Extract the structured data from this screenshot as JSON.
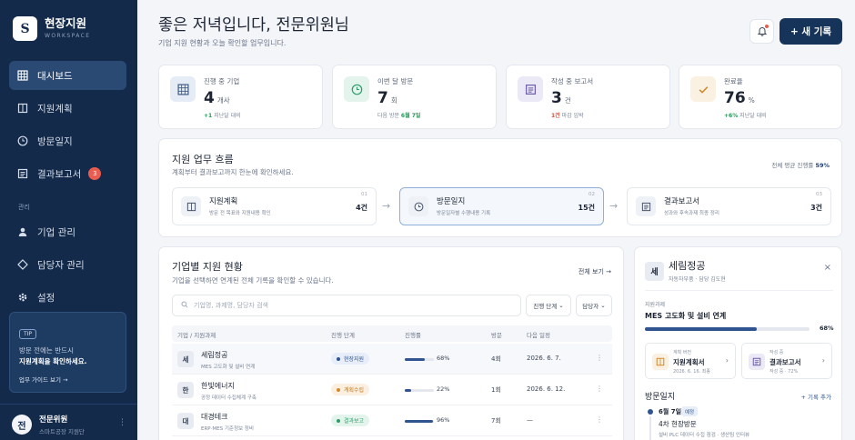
{
  "sidebar": {
    "logo_letter": "S",
    "brand": "현장지원",
    "brand_sub": "WORKSPACE",
    "nav": [
      {
        "label": "대시보드",
        "icon": "grid-icon"
      },
      {
        "label": "지원계획",
        "icon": "book-icon"
      },
      {
        "label": "방문일지",
        "icon": "clock-icon"
      },
      {
        "label": "결과보고서",
        "icon": "report-icon",
        "badge": "3"
      }
    ],
    "section_label": "관리",
    "manage": [
      {
        "label": "기업 관리",
        "icon": "user-icon"
      },
      {
        "label": "담당자 관리",
        "icon": "diamond-icon"
      },
      {
        "label": "설정",
        "icon": "gear-icon"
      }
    ],
    "tip": {
      "tag": "TIP",
      "line1": "방문 전에는 반드시",
      "line2": "지원계획을 확인하세요.",
      "link": "업무 가이드 보기 →"
    },
    "user": {
      "avatar": "전",
      "name": "전문위원",
      "role": "스마트공장 지원단",
      "more": "⋮"
    }
  },
  "header": {
    "greeting": "좋은 저녁입니다, 전문위원님",
    "subtitle": "기업 지원 현황과 오늘 확인할 업무입니다.",
    "new_button": "+ 새 기록"
  },
  "stats": [
    {
      "label": "진행 중 기업",
      "value": "4",
      "unit": "개사",
      "foot_hl": "+1",
      "foot": " 지난달 대비",
      "hl": "green",
      "icon": "grid-icon",
      "color": "#e6ecf5",
      "icon_color": "#3e5b86"
    },
    {
      "label": "이번 달 방문",
      "value": "7",
      "unit": "회",
      "foot_pre": "다음 방문 ",
      "foot_hl": "6월 7일",
      "foot": "",
      "hl": "green",
      "icon": "clock-icon",
      "color": "#e3f4ec",
      "icon_color": "#2f9a6a"
    },
    {
      "label": "작성 중 보고서",
      "value": "3",
      "unit": "건",
      "foot_hl": "1건",
      "foot": " 마감 임박",
      "hl": "red",
      "icon": "report-icon",
      "color": "#ece9f6",
      "icon_color": "#6c5ca8"
    },
    {
      "label": "완료율",
      "value": "76",
      "unit": "%",
      "foot_hl": "+6%",
      "foot": " 지난달 대비",
      "hl": "green",
      "icon": "check-icon",
      "color": "#fbf1e2",
      "icon_color": "#d18a2b"
    }
  ],
  "flow": {
    "title": "지원 업무 흐름",
    "subtitle": "계획부터 결과보고까지 한눈에 확인하세요.",
    "rate_label": "전체 평균 진행률",
    "rate_value": "59%",
    "steps": [
      {
        "num": "01",
        "name": "지원계획",
        "desc": "방문 전 목표와 지원내용 확인",
        "count": "4건",
        "icon": "book-icon"
      },
      {
        "num": "02",
        "name": "방문일지",
        "desc": "방문일자별 수행내용 기록",
        "count": "15건",
        "icon": "clock-icon"
      },
      {
        "num": "03",
        "name": "결과보고서",
        "desc": "성과와 후속과제 최종 정리",
        "count": "3건",
        "icon": "report-icon"
      }
    ],
    "arrow": "→"
  },
  "table": {
    "title": "기업별 지원 현황",
    "subtitle": "기업을 선택하면 연계된 전체 기록을 확인할 수 있습니다.",
    "view_all": "전체 보기 →",
    "search_placeholder": "기업명, 과제명, 담당자 검색",
    "filter_stage": "진행 단계",
    "filter_owner": "담당자",
    "headers": [
      "기업 / 지원과제",
      "진행 단계",
      "진행률",
      "방문",
      "다음 일정"
    ],
    "rows": [
      {
        "icon": "세",
        "name": "세림정공",
        "task": "MES 고도화 및 설비 연계",
        "stage": "현장지원",
        "stage_bg": "#e7eef9",
        "stage_fg": "#2f5490",
        "progress": 68,
        "pct": "68%",
        "visits": "4회",
        "next": "2026. 6. 7.",
        "more": "⋮"
      },
      {
        "icon": "한",
        "name": "한빛에너지",
        "task": "공정 데이터 수집체계 구축",
        "stage": "계획수립",
        "stage_bg": "#fbefe0",
        "stage_fg": "#c27a1f",
        "progress": 22,
        "pct": "22%",
        "visits": "1회",
        "next": "2026. 6. 12.",
        "more": "⋮"
      },
      {
        "icon": "대",
        "name": "대경테크",
        "task": "ERP·MES 기준정보 정비",
        "stage": "결과보고",
        "stage_bg": "#e3f4ec",
        "stage_fg": "#2f9a6a",
        "progress": 96,
        "pct": "96%",
        "visits": "7회",
        "next": "—",
        "more": "⋮"
      }
    ]
  },
  "detail": {
    "icon": "세",
    "name": "세림정공",
    "meta": "자동차부품 · 담당 김도현",
    "close": "×",
    "task_label": "지원과제",
    "task": "MES 고도화 및 설비 연계",
    "progress": 68,
    "pct": "68%",
    "docs": [
      {
        "label": "계획 버전",
        "name": "지원계획서",
        "sub": "2026. 6. 16. 최종",
        "icon": "book-icon",
        "color": "#fbf1e2",
        "icon_color": "#d18a2b"
      },
      {
        "label": "작성 중",
        "name": "결과보고서",
        "sub": "작성 중 · 72%",
        "icon": "report-icon",
        "color": "#ece9f6",
        "icon_color": "#6c5ca8"
      }
    ],
    "visits_title": "방문일지",
    "visits_add": "+ 기록 추가",
    "visit": {
      "date": "6월 7일",
      "tag": "예정",
      "name": "4차 현장방문",
      "note": "설비 PLC 데이터 수집 점검 · 생산팀 인터뷰"
    }
  }
}
